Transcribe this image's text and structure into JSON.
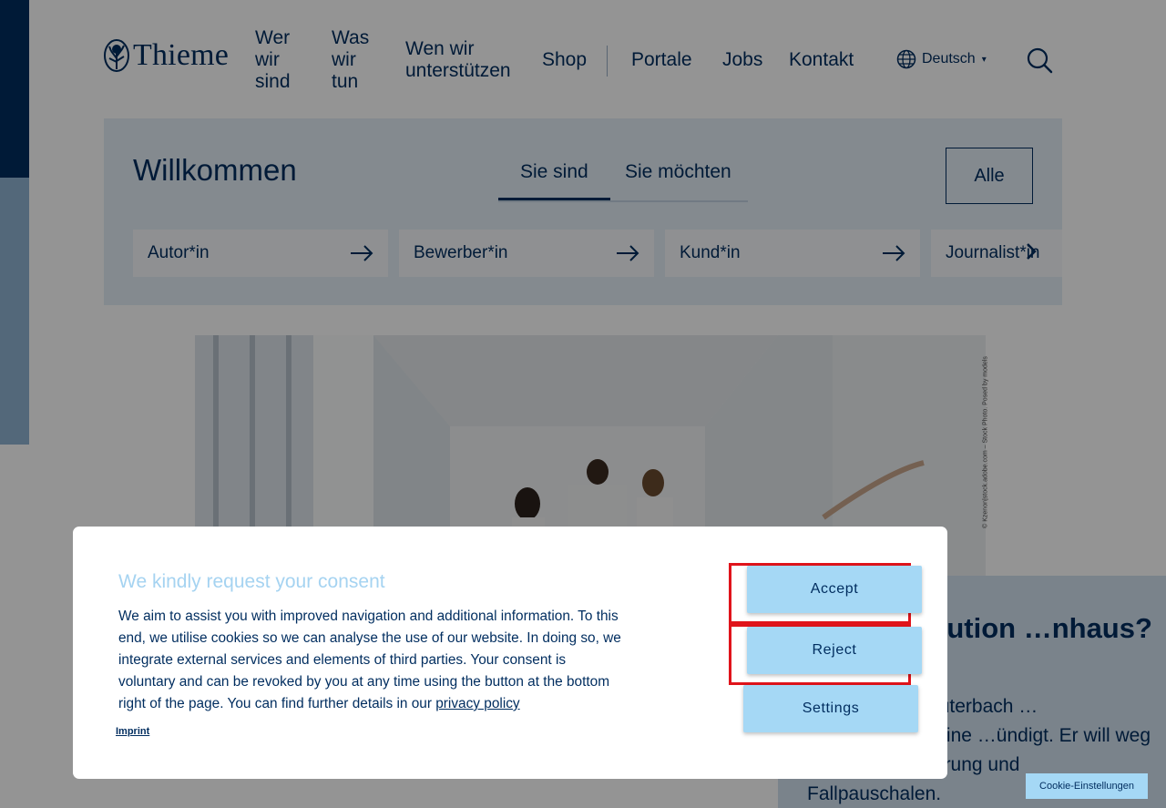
{
  "brand": {
    "logo_text": "Thieme",
    "primary": "#002d5f",
    "accent": "#a5d8f5",
    "panel_bg": "#e4eef6",
    "highlight": "#e0141b"
  },
  "nav": {
    "items": [
      "Wer\nwir\nsind",
      "Was\nwir\ntun",
      "Wen wir\nunterstützen",
      "Shop",
      "Portale",
      "Jobs",
      "Kontakt"
    ],
    "language": "Deutsch",
    "icons": {
      "language": "globe-icon",
      "search": "search-icon"
    }
  },
  "welcome": {
    "title": "Willkommen",
    "tabs": [
      "Sie sind",
      "Sie möchten"
    ],
    "active_tab": "Sie sind",
    "all_label": "Alle",
    "roles": [
      "Autor*in",
      "Bewerber*in",
      "Kund*in",
      "Journalist*in"
    ]
  },
  "hero": {
    "credit": "© Kzenon|stock.adobe.com – Stock Photo. Posed by models"
  },
  "article": {
    "title": "…er Revolution …nhaus?",
    "text": "…itsminister Lauterbach …tenhausreform eine …ündigt. Er will weg von Ökonomisierung und Fallpauschalen."
  },
  "consent": {
    "title": "We kindly request your consent",
    "text": "We aim to assist you with improved navigation and additional information. To this end, we utilise cookies so we can analyse the use of our website. In doing so, we integrate external services and elements of third parties. Your consent is voluntary and can be revoked by you at any time using the button at the bottom right of the page. You can find further details in our",
    "link": "privacy policy",
    "imprint": "Imprint",
    "accept": "Accept",
    "reject": "Reject",
    "settings": "Settings"
  },
  "cookie_settings": "Cookie-Einstellungen"
}
